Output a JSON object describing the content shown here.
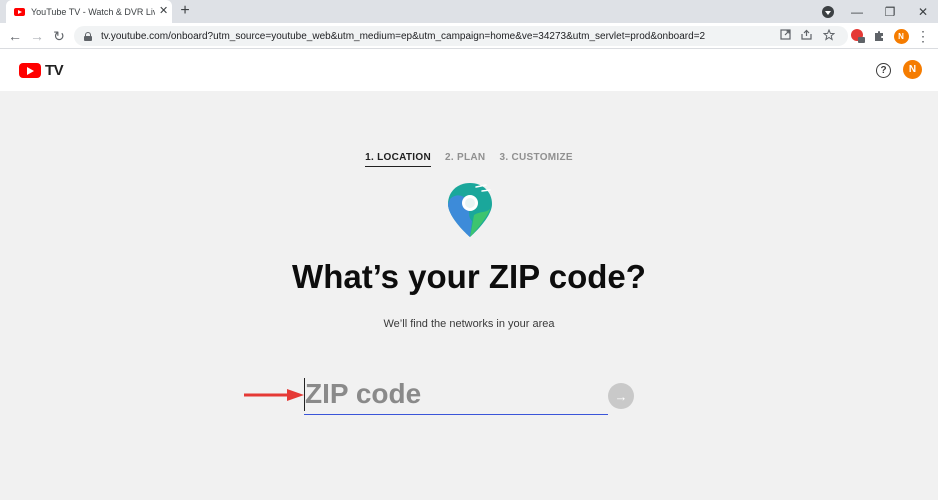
{
  "browser": {
    "tab_title": "YouTube TV - Watch & DVR Live",
    "tab_close": "✕",
    "new_tab": "+",
    "url": "tv.youtube.com/onboard?utm_source=youtube_web&utm_medium=ep&utm_campaign=home&ve=34273&utm_servlet=prod&onboard=2",
    "profile_initial": "N",
    "ext_badge": "1",
    "window_controls": {
      "minimize": "—",
      "restore": "❐",
      "close": "✕"
    },
    "nav": {
      "back": "←",
      "forward": "→",
      "reload": "↻",
      "menu": "⋮"
    },
    "icons": [
      "install-app-icon",
      "share-icon",
      "bookmark-star-icon",
      "puzzle-extension-icon"
    ]
  },
  "header": {
    "logo_text": "TV",
    "help_label": "?",
    "avatar_initial": "N"
  },
  "onboarding": {
    "steps": [
      {
        "label": "1. LOCATION",
        "active": true
      },
      {
        "label": "2. PLAN",
        "active": false
      },
      {
        "label": "3. CUSTOMIZE",
        "active": false
      }
    ],
    "heading": "What’s your ZIP code?",
    "subtext": "We’ll find the networks in your area",
    "zip": {
      "placeholder": "ZIP code",
      "value": ""
    },
    "submit_icon": "→"
  },
  "colors": {
    "brand_red": "#ff0000",
    "avatar_orange": "#f57c00",
    "input_underline": "#3b55d9",
    "annotation_arrow": "#e53935",
    "pin_teal": "#1aa79b",
    "pin_blue": "#3d8bd9",
    "pin_green": "#3dc46f"
  }
}
